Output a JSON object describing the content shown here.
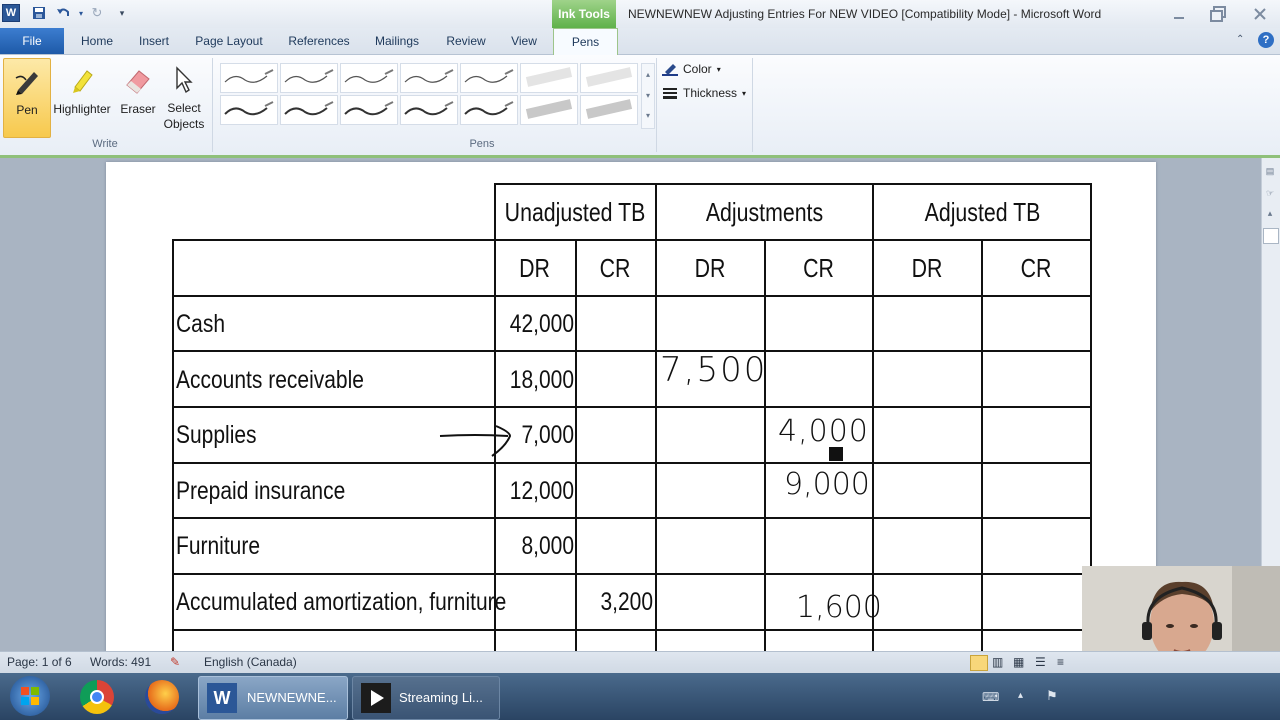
{
  "titlebar": {
    "context_tab": "Ink Tools",
    "document_title": "NEWNEWNEW Adjusting Entries For NEW VIDEO [Compatibility Mode] - Microsoft Word",
    "word_logo": "W"
  },
  "menu_tabs": [
    "File",
    "Home",
    "Insert",
    "Page Layout",
    "References",
    "Mailings",
    "Review",
    "View",
    "Pens"
  ],
  "ribbon": {
    "write_group": {
      "label": "Write",
      "buttons": [
        "Pen",
        "Highlighter",
        "Eraser",
        "Select Objects"
      ]
    },
    "pens_group": {
      "label": "Pens"
    },
    "color_label": "Color",
    "thickness_label": "Thickness"
  },
  "table": {
    "group_headers": [
      "Unadjusted TB",
      "Adjustments",
      "Adjusted TB"
    ],
    "sub_headers": [
      "DR",
      "CR",
      "DR",
      "CR",
      "DR",
      "CR"
    ],
    "rows": [
      {
        "account": "Cash",
        "unadj_dr": "42,000",
        "unadj_cr": ""
      },
      {
        "account": "Accounts receivable",
        "unadj_dr": "18,000",
        "unadj_cr": ""
      },
      {
        "account": "Supplies",
        "unadj_dr": "7,000",
        "unadj_cr": ""
      },
      {
        "account": "Prepaid insurance",
        "unadj_dr": "12,000",
        "unadj_cr": ""
      },
      {
        "account": "Furniture",
        "unadj_dr": "8,000",
        "unadj_cr": ""
      },
      {
        "account": "Accumulated amortization, furniture",
        "unadj_dr": "",
        "unadj_cr": "3,200"
      }
    ],
    "handwritten": {
      "ar_adj_dr": "7,500",
      "supplies_adj_cr": "4,000",
      "prepaid_adj_cr": "9,000",
      "accum_adj_cr": "1,600"
    }
  },
  "statusbar": {
    "page": "Page: 1 of 6",
    "words": "Words: 491",
    "language": "English (Canada)"
  },
  "taskbar": {
    "items": [
      "NEWNEWNE...",
      "Streaming Li..."
    ]
  }
}
